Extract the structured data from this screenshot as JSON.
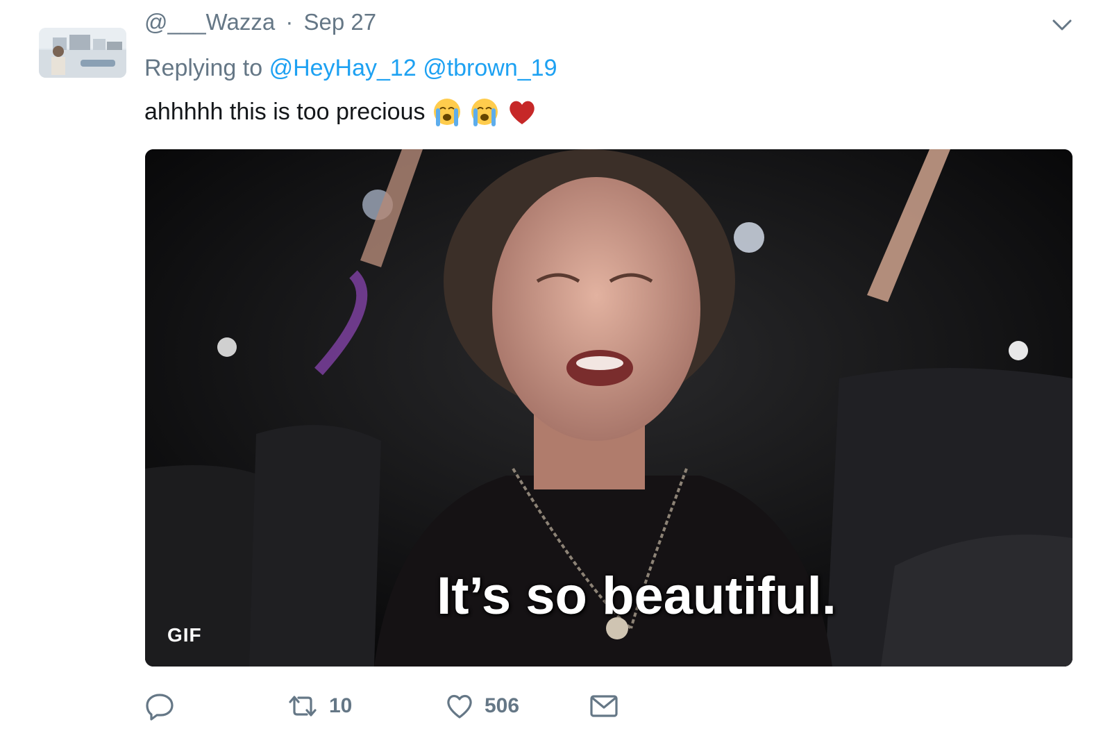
{
  "tweet": {
    "username": "@___Wazza",
    "separator": "·",
    "date": "Sep 27",
    "replying_prefix": "Replying to",
    "mentions": [
      "@HeyHay_12",
      "@tbrown_19"
    ],
    "text": "ahhhhh this is too precious",
    "emojis": [
      "crying-face-emoji",
      "crying-face-emoji",
      "red-heart-emoji"
    ]
  },
  "media": {
    "caption": "It’s so beautiful.",
    "badge": "GIF"
  },
  "actions": {
    "reply_icon": "reply-icon",
    "retweet_count": "10",
    "like_count": "506",
    "dm_icon": "envelope-icon"
  },
  "colors": {
    "secondary_text": "#657786",
    "link": "#1da1f2",
    "heart": "#c62828"
  }
}
